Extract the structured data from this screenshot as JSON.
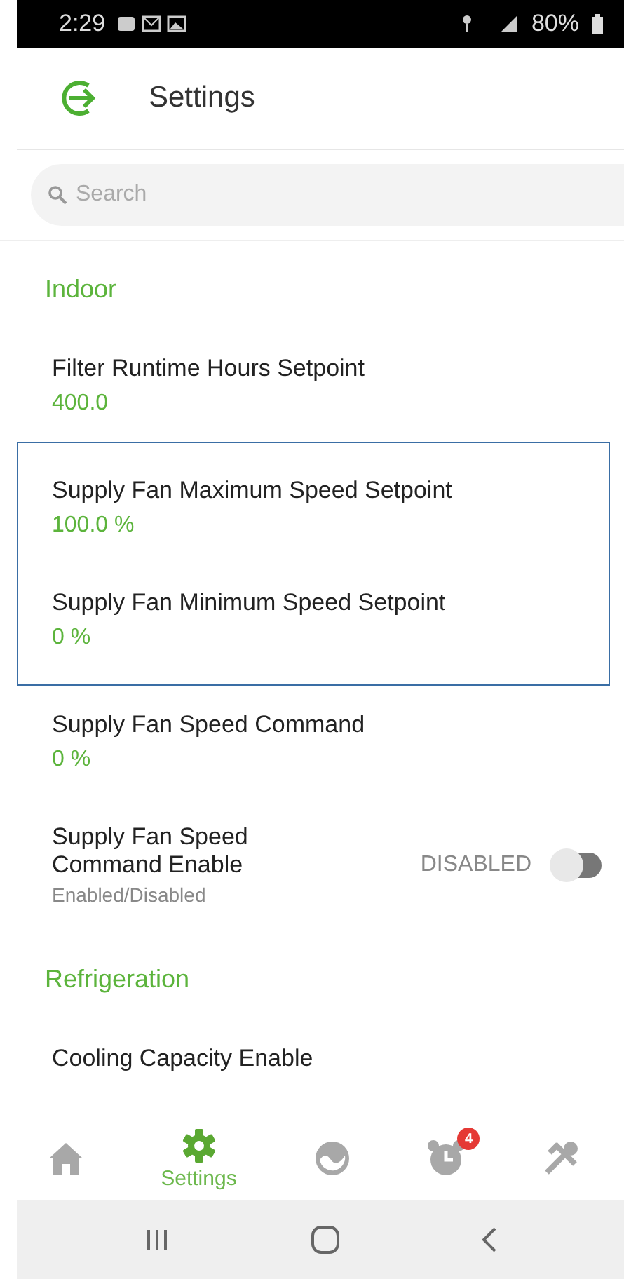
{
  "status_bar": {
    "time": "2:29",
    "battery": "80%"
  },
  "header": {
    "title": "Settings"
  },
  "search": {
    "placeholder": "Search"
  },
  "sections": [
    {
      "title": "Indoor",
      "items": [
        {
          "kind": "value",
          "label": "Filter Runtime Hours Setpoint",
          "value": "400.0",
          "highlighted": false
        },
        {
          "kind": "value",
          "label": "Supply Fan Maximum Speed Setpoint",
          "value": "100.0 %",
          "highlighted": true
        },
        {
          "kind": "value",
          "label": "Supply Fan Minimum Speed Setpoint",
          "value": "0 %",
          "highlighted": true
        },
        {
          "kind": "value",
          "label": "Supply Fan Speed Command",
          "value": "0 %",
          "highlighted": false
        },
        {
          "kind": "toggle",
          "label": "Supply Fan Speed Command Enable",
          "hint": "Enabled/Disabled",
          "state_text": "DISABLED",
          "on": false,
          "highlighted": false
        }
      ]
    },
    {
      "title": "Refrigeration",
      "items": [
        {
          "kind": "value",
          "label": "Cooling Capacity Enable",
          "highlighted": false
        }
      ]
    }
  ],
  "tabs": [
    {
      "kind": "home",
      "selected": false
    },
    {
      "kind": "gear",
      "label": "Settings",
      "selected": true
    },
    {
      "kind": "gauge",
      "selected": false
    },
    {
      "kind": "alarm",
      "badge": "4",
      "selected": false
    },
    {
      "kind": "tools",
      "selected": false
    }
  ]
}
